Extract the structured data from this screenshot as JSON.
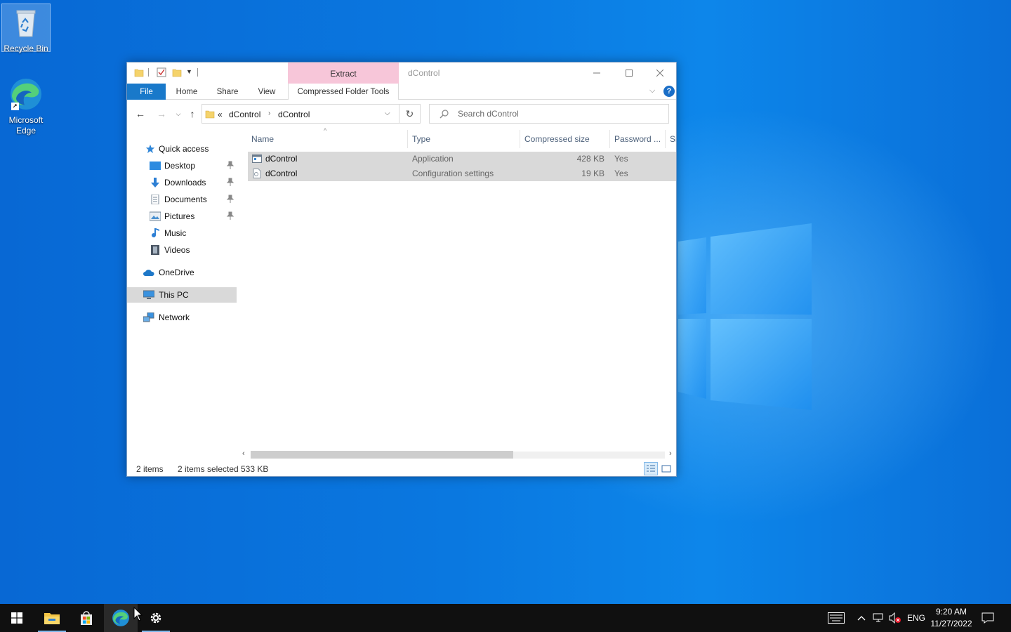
{
  "desktop": {
    "icons": [
      {
        "label": "Recycle Bin"
      },
      {
        "label": "Microsoft Edge"
      }
    ]
  },
  "explorer": {
    "title": "dControl",
    "context_tab_header": "Extract",
    "ribbon_tabs": [
      "File",
      "Home",
      "Share",
      "View",
      "Compressed Folder Tools"
    ],
    "address": {
      "overflow": "«",
      "segments": [
        "dControl",
        "dControl"
      ]
    },
    "search_placeholder": "Search dControl",
    "nav": {
      "quick_access": "Quick access",
      "pinned": [
        {
          "label": "Desktop"
        },
        {
          "label": "Downloads"
        },
        {
          "label": "Documents"
        },
        {
          "label": "Pictures"
        }
      ],
      "music": "Music",
      "videos": "Videos",
      "onedrive": "OneDrive",
      "this_pc": "This PC",
      "network": "Network"
    },
    "columns": [
      "Name",
      "Type",
      "Compressed size",
      "Password ...",
      "Si"
    ],
    "files": [
      {
        "name": "dControl",
        "type": "Application",
        "compressed_size": "428 KB",
        "password": "Yes",
        "icon": "application-icon"
      },
      {
        "name": "dControl",
        "type": "Configuration settings",
        "compressed_size": "19 KB",
        "password": "Yes",
        "icon": "config-file-icon"
      }
    ],
    "status": {
      "items": "2 items",
      "selected": "2 items selected",
      "size": "533 KB"
    }
  },
  "taskbar": {
    "apps": [
      "start-icon",
      "file-explorer-icon",
      "store-icon",
      "edge-icon",
      "settings-icon"
    ],
    "language": "ENG",
    "time": "9:20 AM",
    "date": "11/27/2022"
  },
  "colors": {
    "ribbon_file_tab": "#1979ca",
    "context_tab": "#f7c6d9",
    "selection": "#d9d9d9",
    "taskbar": "#101010"
  }
}
